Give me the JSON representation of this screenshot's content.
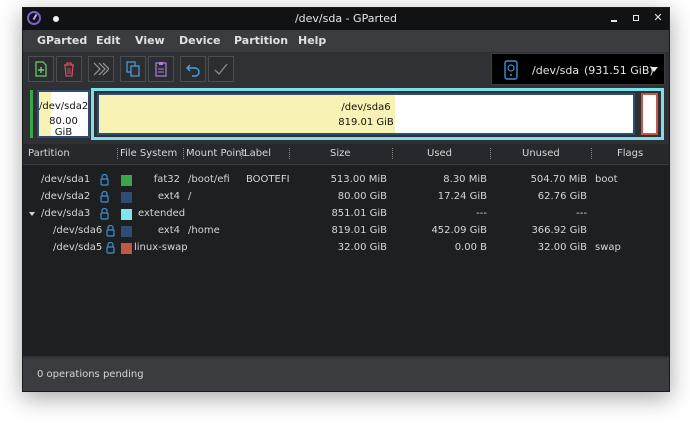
{
  "window": {
    "title": "/dev/sda - GParted"
  },
  "menu": [
    "GParted",
    "Edit",
    "View",
    "Device",
    "Partition",
    "Help"
  ],
  "toolbar": {
    "buttons": [
      "new-partition",
      "delete",
      "apply-all",
      "copy",
      "paste",
      "undo",
      "apply"
    ]
  },
  "device": {
    "path": "/dev/sda",
    "size": "(931.51 GiB)"
  },
  "diskmap": {
    "partitions": [
      {
        "name": "/dev/sda2",
        "size": "80.00 GiB"
      },
      {
        "name": "/dev/sda6",
        "size": "819.01 GiB"
      }
    ]
  },
  "columns": [
    "Partition",
    "File System",
    "Mount Point",
    "Label",
    "Size",
    "Used",
    "Unused",
    "Flags"
  ],
  "rows": [
    {
      "partition": "/dev/sda1",
      "fs": "fat32",
      "mount": "/boot/efi",
      "label": "BOOTEFI",
      "size": "513.00 MiB",
      "used": "8.30 MiB",
      "unused": "504.70 MiB",
      "flags": "boot",
      "color": "#3aa849"
    },
    {
      "partition": "/dev/sda2",
      "fs": "ext4",
      "mount": "/",
      "label": "",
      "size": "80.00 GiB",
      "used": "17.24 GiB",
      "unused": "62.76 GiB",
      "flags": "",
      "color": "#2e4d74"
    },
    {
      "partition": "/dev/sda3",
      "fs": "extended",
      "mount": "",
      "label": "",
      "size": "851.01 GiB",
      "used": "---",
      "unused": "---",
      "flags": "",
      "color": "#7fe6f0"
    },
    {
      "partition": "/dev/sda6",
      "fs": "ext4",
      "mount": "/home",
      "label": "",
      "size": "819.01 GiB",
      "used": "452.09 GiB",
      "unused": "366.92 GiB",
      "flags": "",
      "color": "#2e4d74"
    },
    {
      "partition": "/dev/sda5",
      "fs": "linux-swap",
      "mount": "",
      "label": "",
      "size": "32.00 GiB",
      "used": "0.00 B",
      "unused": "32.00 GiB",
      "flags": "swap",
      "color": "#c0584a"
    }
  ],
  "status": "0 operations pending",
  "colors": {
    "fat32": "#3aa849",
    "ext4": "#2e4d74",
    "extended": "#7fe6f0",
    "swap": "#c0584a",
    "used_fill": "#f8f3b4",
    "free_fill": "#ffffff",
    "selection_border": "#7ee0ea"
  }
}
